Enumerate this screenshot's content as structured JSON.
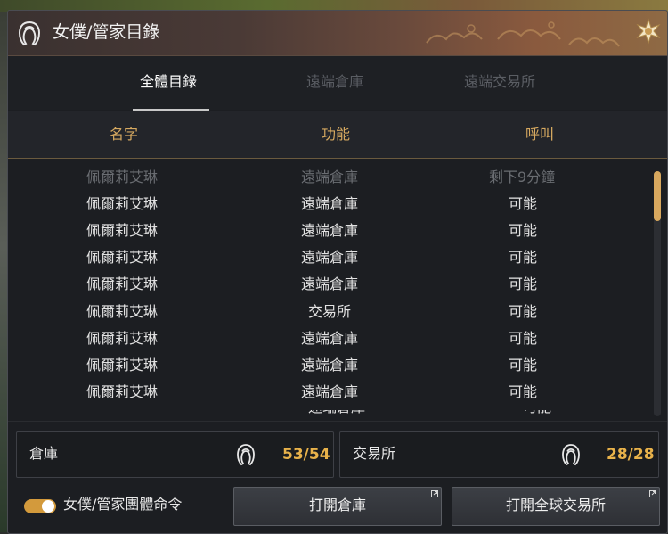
{
  "window": {
    "title": "女僕/管家目錄"
  },
  "tabs": [
    {
      "label": "全體目錄",
      "active": true
    },
    {
      "label": "遠端倉庫",
      "active": false
    },
    {
      "label": "遠端交易所",
      "active": false
    }
  ],
  "columns": {
    "name": "名字",
    "function": "功能",
    "call": "呼叫"
  },
  "rows": [
    {
      "name": "佩爾莉艾琳",
      "function": "遠端倉庫",
      "call": "剩下9分鐘",
      "available": false
    },
    {
      "name": "佩爾莉艾琳",
      "function": "遠端倉庫",
      "call": "可能",
      "available": true
    },
    {
      "name": "佩爾莉艾琳",
      "function": "遠端倉庫",
      "call": "可能",
      "available": true
    },
    {
      "name": "佩爾莉艾琳",
      "function": "遠端倉庫",
      "call": "可能",
      "available": true
    },
    {
      "name": "佩爾莉艾琳",
      "function": "遠端倉庫",
      "call": "可能",
      "available": true
    },
    {
      "name": "佩爾莉艾琳",
      "function": "交易所",
      "call": "可能",
      "available": true
    },
    {
      "name": "佩爾莉艾琳",
      "function": "遠端倉庫",
      "call": "可能",
      "available": true
    },
    {
      "name": "佩爾莉艾琳",
      "function": "遠端倉庫",
      "call": "可能",
      "available": true
    },
    {
      "name": "佩爾莉艾琳",
      "function": "遠端倉庫",
      "call": "可能",
      "available": true
    }
  ],
  "storage": {
    "label": "倉庫",
    "count": "53/54"
  },
  "market": {
    "label": "交易所",
    "count": "28/28"
  },
  "footer": {
    "toggle_label": "女僕/管家團體命令",
    "toggle_on": true,
    "open_storage": "打開倉庫",
    "open_market": "打開全球交易所"
  },
  "icons": {
    "title": "maid-icon",
    "close": "star-close-icon",
    "storage": "maid-icon",
    "market": "maid-icon"
  },
  "colors": {
    "accent_gold": "#d6a960",
    "count_color": "#e8b24a",
    "toggle_on": "#d39a3c"
  }
}
